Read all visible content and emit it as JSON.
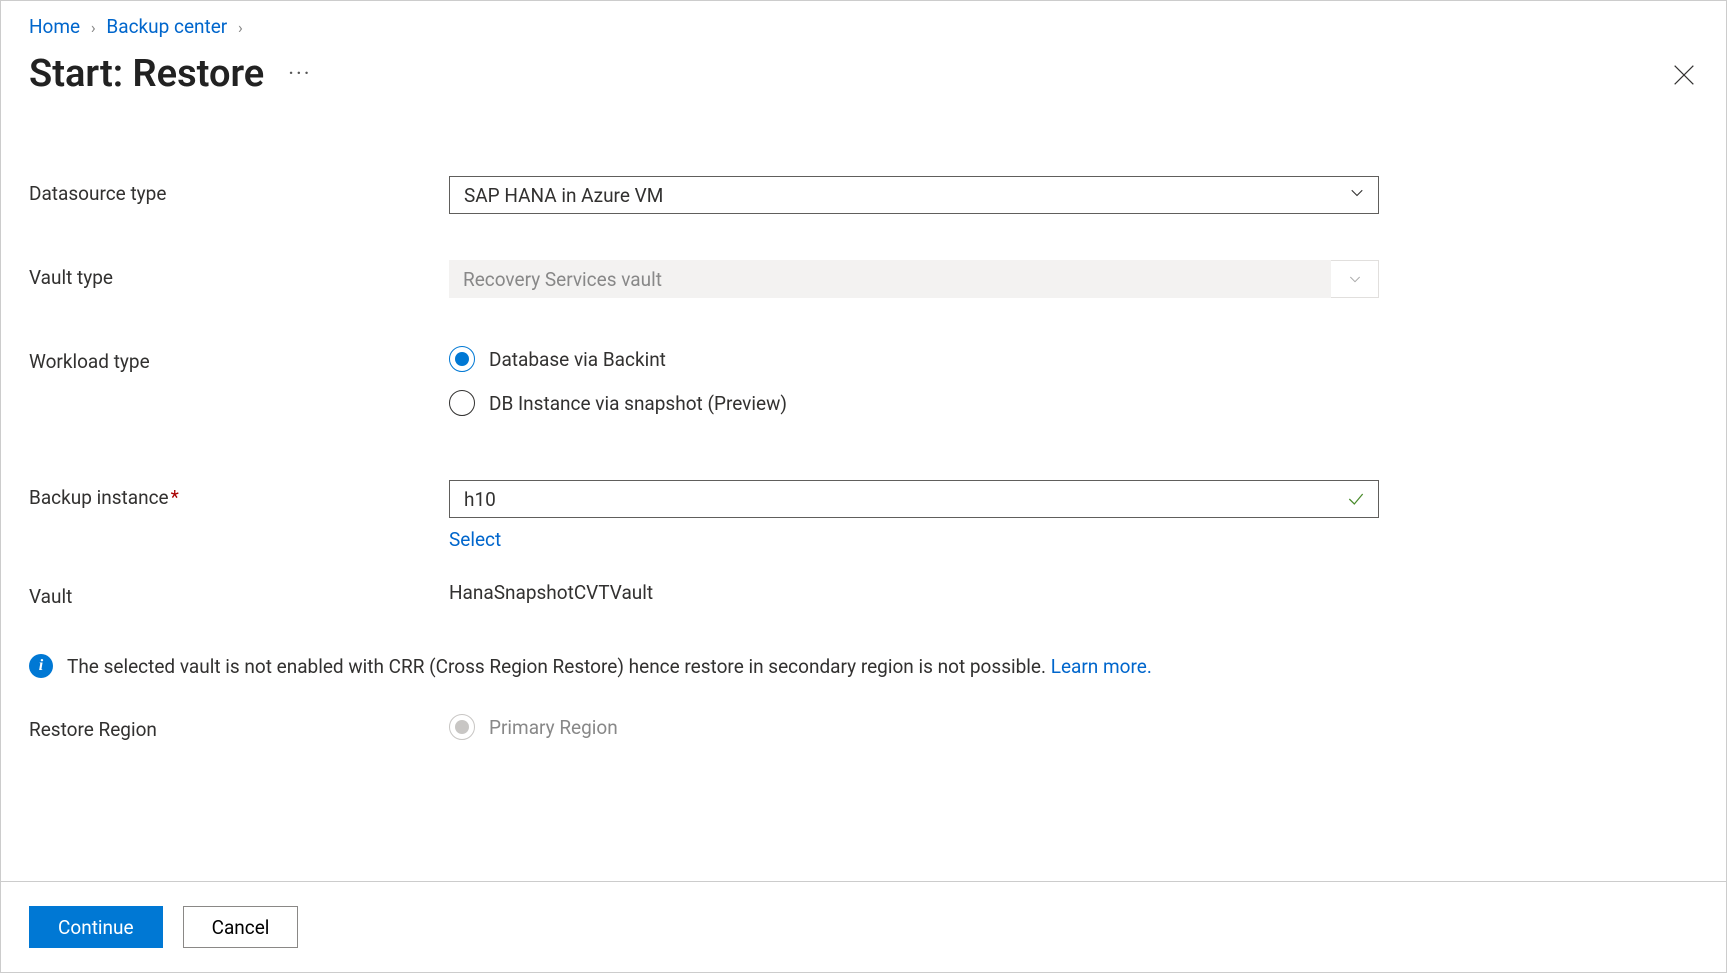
{
  "breadcrumb": {
    "home": "Home",
    "backup_center": "Backup center"
  },
  "title": "Start: Restore",
  "ellipsis": "···",
  "form": {
    "datasource_type": {
      "label": "Datasource type",
      "value": "SAP HANA in Azure VM"
    },
    "vault_type": {
      "label": "Vault type",
      "value": "Recovery Services vault"
    },
    "workload_type": {
      "label": "Workload type",
      "options": [
        {
          "label": "Database via Backint",
          "selected": true
        },
        {
          "label": "DB Instance via snapshot (Preview)",
          "selected": false
        }
      ]
    },
    "backup_instance": {
      "label": "Backup instance",
      "value": "h10",
      "select_link": "Select"
    },
    "vault": {
      "label": "Vault",
      "value": "HanaSnapshotCVTVault"
    },
    "info": {
      "text": "The selected vault is not enabled with CRR (Cross Region Restore) hence restore in secondary region is not possible. ",
      "learn_more": "Learn more."
    },
    "restore_region": {
      "label": "Restore Region",
      "options": [
        {
          "label": "Primary Region",
          "selected": true
        }
      ]
    }
  },
  "footer": {
    "continue": "Continue",
    "cancel": "Cancel"
  }
}
